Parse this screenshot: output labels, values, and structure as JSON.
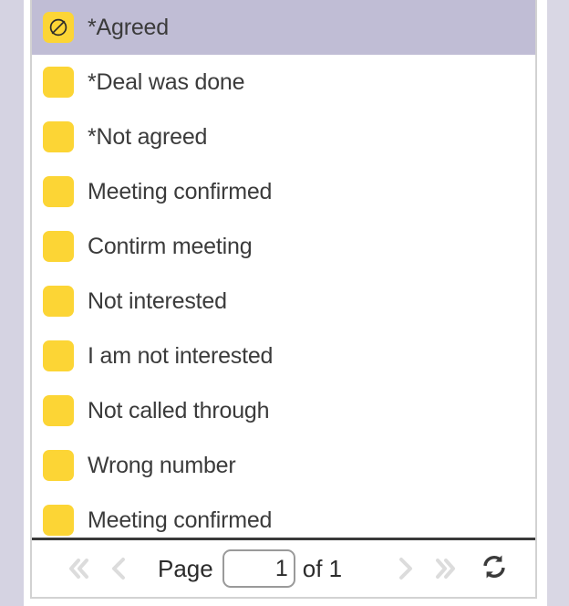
{
  "panel": {
    "title": "status-options-dropdown",
    "selected_index": 0,
    "colors": {
      "swatch": "#fcd535",
      "selected_row": "#c0bdd5",
      "text": "#3b3b3b",
      "disabled_control": "#dcdcdc",
      "enabled_control": "#3a3a3a",
      "panel_border": "#d2d2d2",
      "edge_strip_left": "#d5d3e2",
      "edge_strip_right": "#d9d7e4"
    },
    "items": [
      {
        "label": "*Agreed",
        "icon": "no-entry-slashed-circle-icon",
        "selected": true
      },
      {
        "label": "*Deal was done",
        "icon": "color-swatch-icon",
        "selected": false
      },
      {
        "label": "*Not agreed",
        "icon": "color-swatch-icon",
        "selected": false
      },
      {
        "label": "Meeting confirmed",
        "icon": "color-swatch-icon",
        "selected": false
      },
      {
        "label": "Contirm meeting",
        "icon": "color-swatch-icon",
        "selected": false
      },
      {
        "label": "Not interested",
        "icon": "color-swatch-icon",
        "selected": false
      },
      {
        "label": "I am not interested",
        "icon": "color-swatch-icon",
        "selected": false
      },
      {
        "label": "Not called through",
        "icon": "color-swatch-icon",
        "selected": false
      },
      {
        "label": "Wrong number",
        "icon": "color-swatch-icon",
        "selected": false
      },
      {
        "label": "Meeting confirmed",
        "icon": "color-swatch-icon",
        "selected": false
      }
    ]
  },
  "pagination": {
    "first_page_icon": "double-chevron-left-icon",
    "prev_page_icon": "chevron-left-icon",
    "next_page_icon": "chevron-right-icon",
    "last_page_icon": "double-chevron-right-icon",
    "refresh_icon": "refresh-icon",
    "page_label": "Page",
    "page_value": "1",
    "page_placeholder": "",
    "of_label": "of 1",
    "total_pages": "1",
    "first_enabled": false,
    "prev_enabled": false,
    "next_enabled": false,
    "last_enabled": false,
    "refresh_enabled": true
  }
}
